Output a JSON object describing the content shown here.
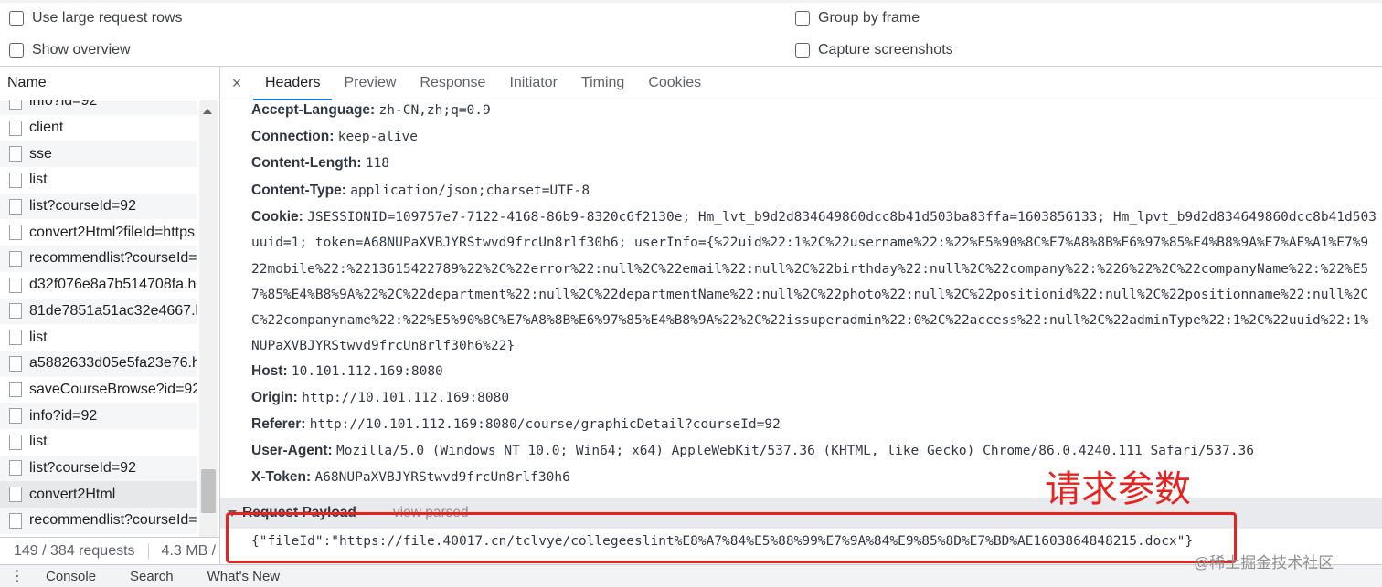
{
  "settings": {
    "use_large_rows": "Use large request rows",
    "show_overview": "Show overview",
    "group_by_frame": "Group by frame",
    "capture_screenshots": "Capture screenshots"
  },
  "request_list": {
    "column_header": "Name",
    "items": [
      "info?id=92",
      "client",
      "sse",
      "list",
      "list?courseId=92",
      "convert2Html?fileId=https",
      "recommendlist?courseId=",
      "d32f076e8a7b514708fa.hc",
      "81de7851a51ac32e4667.h",
      "list",
      "a5882633d05e5fa23e76.h.",
      "saveCourseBrowse?id=92",
      "info?id=92",
      "list",
      "list?courseId=92",
      "convert2Html",
      "recommendlist?courseId="
    ],
    "selected_index": 15,
    "summary_requests": "149 / 384 requests",
    "summary_size": "4.3 MB /"
  },
  "tabs": {
    "close_glyph": "×",
    "items": [
      "Headers",
      "Preview",
      "Response",
      "Initiator",
      "Timing",
      "Cookies"
    ],
    "active": "Headers"
  },
  "headers": {
    "accept_language": {
      "key": "Accept-Language:",
      "value": "zh-CN,zh;q=0.9"
    },
    "connection": {
      "key": "Connection:",
      "value": "keep-alive"
    },
    "content_length": {
      "key": "Content-Length:",
      "value": "118"
    },
    "content_type": {
      "key": "Content-Type:",
      "value": "application/json;charset=UTF-8"
    },
    "cookie": {
      "key": "Cookie:",
      "lines": [
        "JSESSIONID=109757e7-7122-4168-86b9-8320c6f2130e; Hm_lvt_b9d2d834649860dcc8b41d503ba83ffa=1603856133; Hm_lpvt_b9d2d834649860dcc8b41d503",
        "uuid=1; token=A68NUPaXVBJYRStwvd9frcUn8rlf30h6; userInfo={%22uid%22:1%2C%22username%22:%22%E5%90%8C%E7%A8%8B%E6%97%85%E4%B8%9A%E7%AE%A1%E7%9",
        "22mobile%22:%2213615422789%22%2C%22error%22:null%2C%22email%22:null%2C%22birthday%22:null%2C%22company%22:%226%22%2C%22companyName%22:%22%E5",
        "7%85%E4%B8%9A%22%2C%22department%22:null%2C%22departmentName%22:null%2C%22photo%22:null%2C%22positionid%22:null%2C%22positionname%22:null%2C",
        "C%22companyname%22:%22%E5%90%8C%E7%A8%8B%E6%97%85%E4%B8%9A%22%2C%22issuperadmin%22:0%2C%22access%22:null%2C%22adminType%22:1%2C%22uuid%22:1%",
        "NUPaXVBJYRStwvd9frcUn8rlf30h6%22}"
      ]
    },
    "host": {
      "key": "Host:",
      "value": "10.101.112.169:8080"
    },
    "origin": {
      "key": "Origin:",
      "value": "http://10.101.112.169:8080"
    },
    "referer": {
      "key": "Referer:",
      "value": "http://10.101.112.169:8080/course/graphicDetail?courseId=92"
    },
    "user_agent": {
      "key": "User-Agent:",
      "value": "Mozilla/5.0 (Windows NT 10.0; Win64; x64) AppleWebKit/537.36 (KHTML, like Gecko) Chrome/86.0.4240.111 Safari/537.36"
    },
    "x_token": {
      "key": "X-Token:",
      "value": "A68NUPaXVBJYRStwvd9frcUn8rlf30h6"
    }
  },
  "payload": {
    "title": "Request Payload",
    "view_parsed": "view parsed",
    "value": "{\"fileId\":\"https://file.40017.cn/tclvye/collegeeslint%E8%A7%84%E5%88%99%E7%9A%84%E9%85%8D%E7%BD%AE1603864848215.docx\"}"
  },
  "annotation": {
    "text": "请求参数",
    "color": "#e8231f"
  },
  "drawer": {
    "menu_glyph": "⋮",
    "tabs": [
      "Console",
      "Search",
      "What's New"
    ]
  },
  "watermark": "@稀土掘金技术社区",
  "colors": {
    "accent": "#1a73e8",
    "annotation": "#e8231f"
  }
}
